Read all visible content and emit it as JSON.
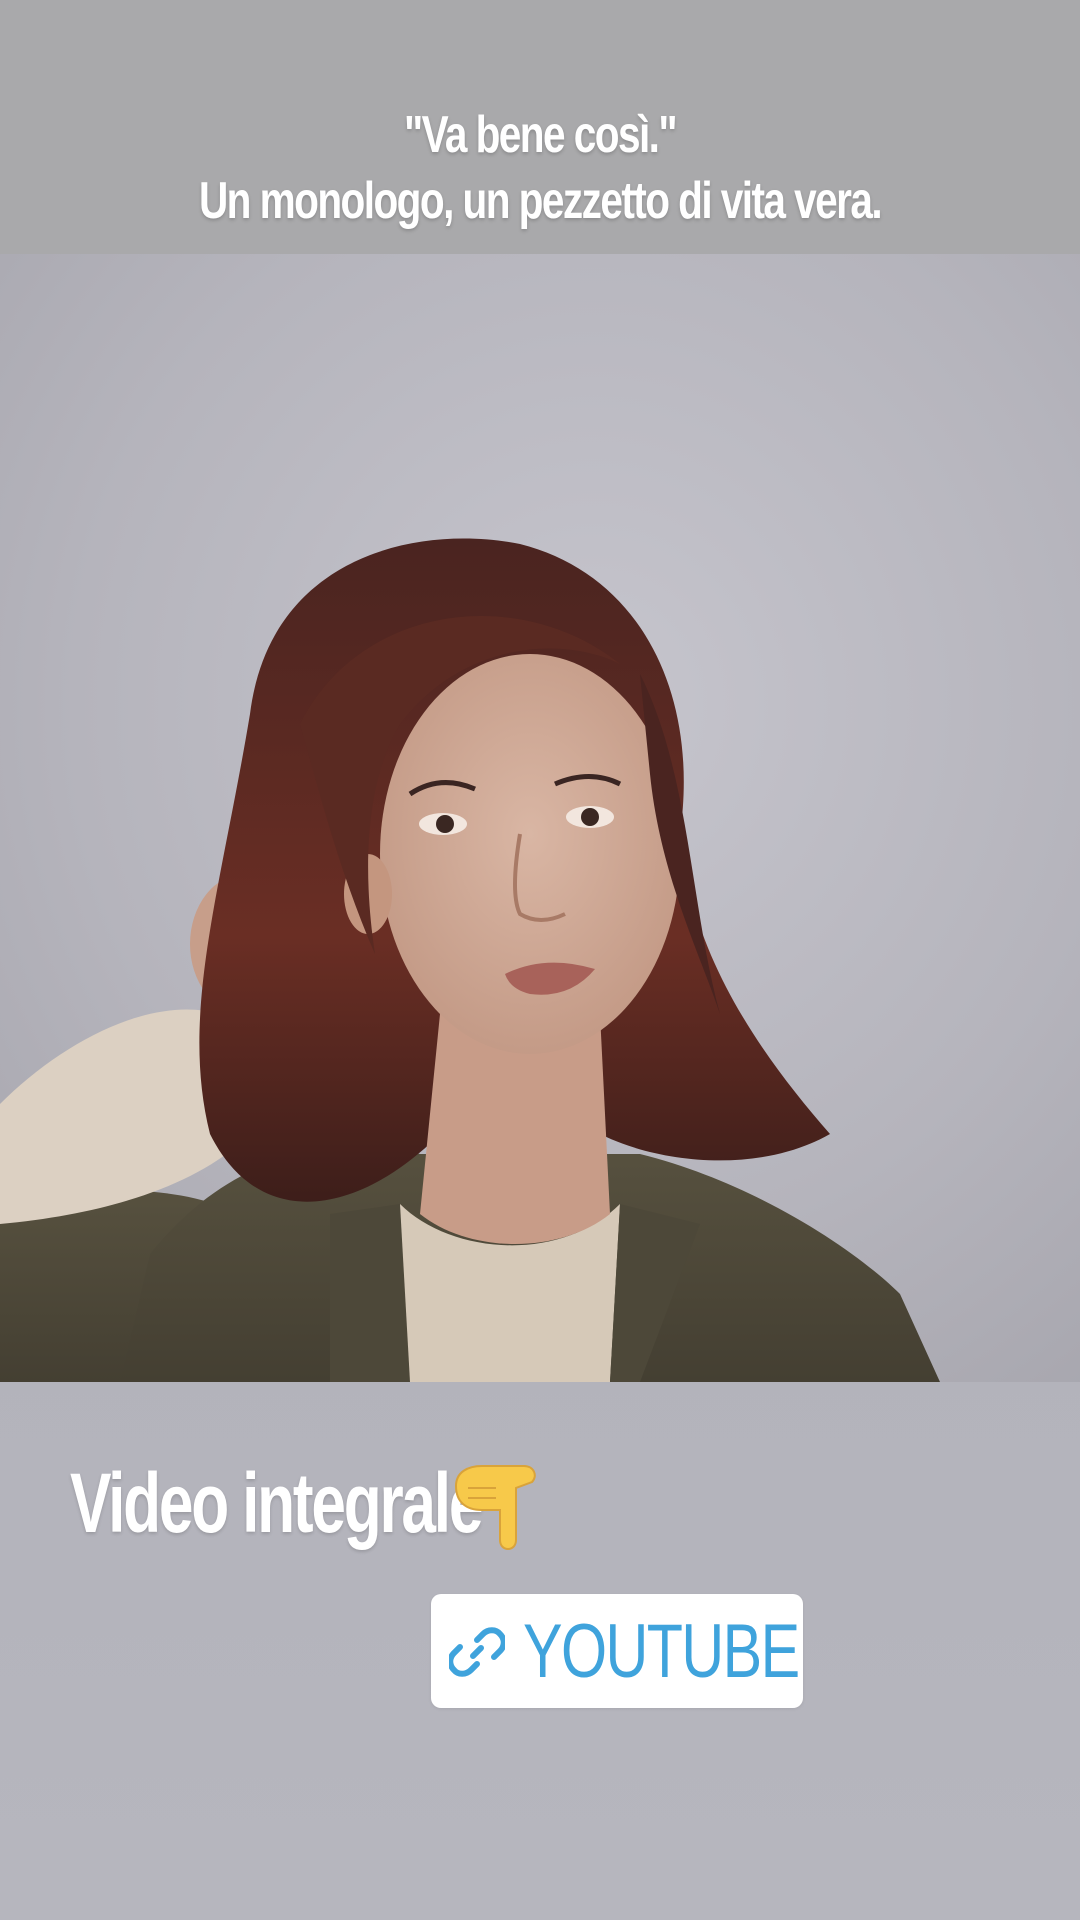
{
  "story": {
    "caption": {
      "line1": "\"Va bene così.\"",
      "line2": "Un monologo, un pezzetto di vita vera."
    },
    "photo": {
      "subject": "portrait-photo"
    },
    "cta": {
      "text": "Video integrale",
      "emoji_icon": "pointing-down-hand-icon"
    },
    "link_sticker": {
      "label": "YOUTUBE",
      "icon": "link-icon",
      "color": "#3fa3dc"
    }
  },
  "colors": {
    "background": "#aaaaad",
    "caption_text": "#ffffff",
    "sticker_bg": "#ffffff",
    "link_blue": "#3fa3dc"
  }
}
